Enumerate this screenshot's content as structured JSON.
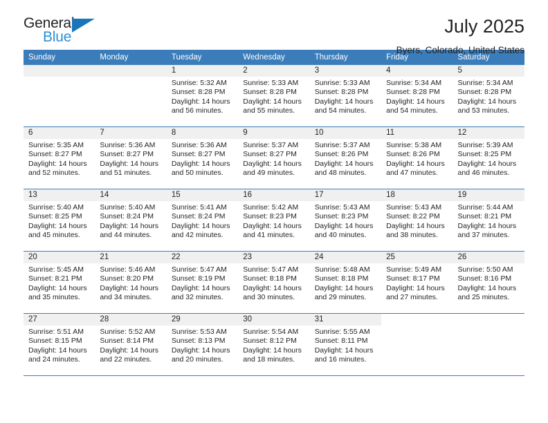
{
  "brand": {
    "name_top": "General",
    "name_bottom": "Blue",
    "triangle_color": "#1b75bb",
    "blue_text_color": "#2d8fd5"
  },
  "header": {
    "title": "July 2025",
    "subtitle": "Byers, Colorado, United States"
  },
  "colors": {
    "header_row_bg": "#3a7dba",
    "header_row_text": "#ffffff",
    "daynum_bg": "#f0f0f0",
    "grid_line": "#3a7dba",
    "body_text": "#231f20"
  },
  "weekdays": [
    "Sunday",
    "Monday",
    "Tuesday",
    "Wednesday",
    "Thursday",
    "Friday",
    "Saturday"
  ],
  "labels": {
    "sunrise_prefix": "Sunrise:",
    "sunset_prefix": "Sunset:",
    "daylight_prefix": "Daylight:"
  },
  "weeks": [
    [
      {
        "empty": true
      },
      {
        "empty": true
      },
      {
        "day": "1",
        "sunrise": "Sunrise: 5:32 AM",
        "sunset": "Sunset: 8:28 PM",
        "daylight": "Daylight: 14 hours and 56 minutes."
      },
      {
        "day": "2",
        "sunrise": "Sunrise: 5:33 AM",
        "sunset": "Sunset: 8:28 PM",
        "daylight": "Daylight: 14 hours and 55 minutes."
      },
      {
        "day": "3",
        "sunrise": "Sunrise: 5:33 AM",
        "sunset": "Sunset: 8:28 PM",
        "daylight": "Daylight: 14 hours and 54 minutes."
      },
      {
        "day": "4",
        "sunrise": "Sunrise: 5:34 AM",
        "sunset": "Sunset: 8:28 PM",
        "daylight": "Daylight: 14 hours and 54 minutes."
      },
      {
        "day": "5",
        "sunrise": "Sunrise: 5:34 AM",
        "sunset": "Sunset: 8:28 PM",
        "daylight": "Daylight: 14 hours and 53 minutes."
      }
    ],
    [
      {
        "day": "6",
        "sunrise": "Sunrise: 5:35 AM",
        "sunset": "Sunset: 8:27 PM",
        "daylight": "Daylight: 14 hours and 52 minutes."
      },
      {
        "day": "7",
        "sunrise": "Sunrise: 5:36 AM",
        "sunset": "Sunset: 8:27 PM",
        "daylight": "Daylight: 14 hours and 51 minutes."
      },
      {
        "day": "8",
        "sunrise": "Sunrise: 5:36 AM",
        "sunset": "Sunset: 8:27 PM",
        "daylight": "Daylight: 14 hours and 50 minutes."
      },
      {
        "day": "9",
        "sunrise": "Sunrise: 5:37 AM",
        "sunset": "Sunset: 8:27 PM",
        "daylight": "Daylight: 14 hours and 49 minutes."
      },
      {
        "day": "10",
        "sunrise": "Sunrise: 5:37 AM",
        "sunset": "Sunset: 8:26 PM",
        "daylight": "Daylight: 14 hours and 48 minutes."
      },
      {
        "day": "11",
        "sunrise": "Sunrise: 5:38 AM",
        "sunset": "Sunset: 8:26 PM",
        "daylight": "Daylight: 14 hours and 47 minutes."
      },
      {
        "day": "12",
        "sunrise": "Sunrise: 5:39 AM",
        "sunset": "Sunset: 8:25 PM",
        "daylight": "Daylight: 14 hours and 46 minutes."
      }
    ],
    [
      {
        "day": "13",
        "sunrise": "Sunrise: 5:40 AM",
        "sunset": "Sunset: 8:25 PM",
        "daylight": "Daylight: 14 hours and 45 minutes."
      },
      {
        "day": "14",
        "sunrise": "Sunrise: 5:40 AM",
        "sunset": "Sunset: 8:24 PM",
        "daylight": "Daylight: 14 hours and 44 minutes."
      },
      {
        "day": "15",
        "sunrise": "Sunrise: 5:41 AM",
        "sunset": "Sunset: 8:24 PM",
        "daylight": "Daylight: 14 hours and 42 minutes."
      },
      {
        "day": "16",
        "sunrise": "Sunrise: 5:42 AM",
        "sunset": "Sunset: 8:23 PM",
        "daylight": "Daylight: 14 hours and 41 minutes."
      },
      {
        "day": "17",
        "sunrise": "Sunrise: 5:43 AM",
        "sunset": "Sunset: 8:23 PM",
        "daylight": "Daylight: 14 hours and 40 minutes."
      },
      {
        "day": "18",
        "sunrise": "Sunrise: 5:43 AM",
        "sunset": "Sunset: 8:22 PM",
        "daylight": "Daylight: 14 hours and 38 minutes."
      },
      {
        "day": "19",
        "sunrise": "Sunrise: 5:44 AM",
        "sunset": "Sunset: 8:21 PM",
        "daylight": "Daylight: 14 hours and 37 minutes."
      }
    ],
    [
      {
        "day": "20",
        "sunrise": "Sunrise: 5:45 AM",
        "sunset": "Sunset: 8:21 PM",
        "daylight": "Daylight: 14 hours and 35 minutes."
      },
      {
        "day": "21",
        "sunrise": "Sunrise: 5:46 AM",
        "sunset": "Sunset: 8:20 PM",
        "daylight": "Daylight: 14 hours and 34 minutes."
      },
      {
        "day": "22",
        "sunrise": "Sunrise: 5:47 AM",
        "sunset": "Sunset: 8:19 PM",
        "daylight": "Daylight: 14 hours and 32 minutes."
      },
      {
        "day": "23",
        "sunrise": "Sunrise: 5:47 AM",
        "sunset": "Sunset: 8:18 PM",
        "daylight": "Daylight: 14 hours and 30 minutes."
      },
      {
        "day": "24",
        "sunrise": "Sunrise: 5:48 AM",
        "sunset": "Sunset: 8:18 PM",
        "daylight": "Daylight: 14 hours and 29 minutes."
      },
      {
        "day": "25",
        "sunrise": "Sunrise: 5:49 AM",
        "sunset": "Sunset: 8:17 PM",
        "daylight": "Daylight: 14 hours and 27 minutes."
      },
      {
        "day": "26",
        "sunrise": "Sunrise: 5:50 AM",
        "sunset": "Sunset: 8:16 PM",
        "daylight": "Daylight: 14 hours and 25 minutes."
      }
    ],
    [
      {
        "day": "27",
        "sunrise": "Sunrise: 5:51 AM",
        "sunset": "Sunset: 8:15 PM",
        "daylight": "Daylight: 14 hours and 24 minutes."
      },
      {
        "day": "28",
        "sunrise": "Sunrise: 5:52 AM",
        "sunset": "Sunset: 8:14 PM",
        "daylight": "Daylight: 14 hours and 22 minutes."
      },
      {
        "day": "29",
        "sunrise": "Sunrise: 5:53 AM",
        "sunset": "Sunset: 8:13 PM",
        "daylight": "Daylight: 14 hours and 20 minutes."
      },
      {
        "day": "30",
        "sunrise": "Sunrise: 5:54 AM",
        "sunset": "Sunset: 8:12 PM",
        "daylight": "Daylight: 14 hours and 18 minutes."
      },
      {
        "day": "31",
        "sunrise": "Sunrise: 5:55 AM",
        "sunset": "Sunset: 8:11 PM",
        "daylight": "Daylight: 14 hours and 16 minutes."
      },
      {
        "blank": true
      },
      {
        "blank": true
      }
    ]
  ]
}
